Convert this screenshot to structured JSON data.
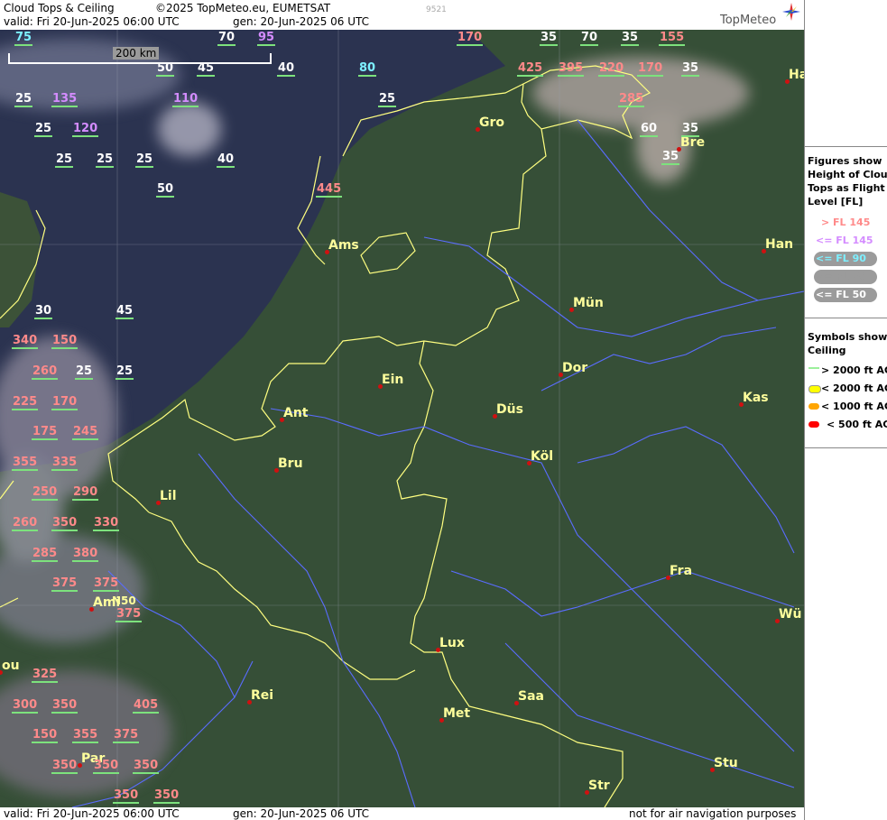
{
  "header": {
    "title": "Cloud Tops & Ceiling",
    "copyright": "©2025 TopMeteo.eu, EUMETSAT",
    "valid": "valid:  Fri  20-Jun-2025  06:00 UTC",
    "gen": "gen: 20-Jun-2025 06 UTC",
    "id": "9521",
    "brand": "TopMeteo"
  },
  "footer": {
    "valid": "valid:  Fri  20-Jun-2025  06:00 UTC",
    "gen": "gen: 20-Jun-2025 06 UTC",
    "disclaimer": "not for air navigation purposes"
  },
  "scale": {
    "label": "200 km"
  },
  "grid_label": "N50",
  "legend": {
    "heights_title": [
      "Figures show",
      "Height of Cloud",
      "Tops as Flight",
      "Level  [FL]"
    ],
    "heights": [
      {
        "label": "> FL 145",
        "color": "#ff8a8a"
      },
      {
        "label": "<= FL 145",
        "color": "#d48cff"
      },
      {
        "label": "<= FL 90",
        "color": "#7df0ff"
      },
      {
        "label": "<= FL 70",
        "color": "#9b9b9b"
      },
      {
        "label": "<= FL 50",
        "color": "#ffffff"
      }
    ],
    "symbols_title": [
      "Symbols show",
      "Ceiling"
    ],
    "symbols": [
      {
        "label": "> 2000 ft AGL",
        "color": "#9cf09c"
      },
      {
        "label": "< 2000 ft AGL",
        "color": "#ffff00"
      },
      {
        "label": "< 1000 ft AGL",
        "color": "#ffa500"
      },
      {
        "label": "< 500 ft AGL",
        "color": "#ff0000"
      }
    ]
  },
  "cities": [
    {
      "name": "Gro"
    },
    {
      "name": "Bre"
    },
    {
      "name": "Ha"
    },
    {
      "name": "Ams"
    },
    {
      "name": "Han"
    },
    {
      "name": "Mün"
    },
    {
      "name": "Ein"
    },
    {
      "name": "Dor"
    },
    {
      "name": "Ant"
    },
    {
      "name": "Düs"
    },
    {
      "name": "Kas"
    },
    {
      "name": "Köl"
    },
    {
      "name": "Bru"
    },
    {
      "name": "Lil"
    },
    {
      "name": "Fra"
    },
    {
      "name": "Ami"
    },
    {
      "name": "Wü"
    },
    {
      "name": "Lux"
    },
    {
      "name": "ou"
    },
    {
      "name": "Rei"
    },
    {
      "name": "Saa"
    },
    {
      "name": "Met"
    },
    {
      "name": "Stu"
    },
    {
      "name": "Par"
    },
    {
      "name": "Str"
    }
  ],
  "cloud_tops": [
    {
      "v": "75",
      "c": "c"
    },
    {
      "v": "70",
      "c": "w"
    },
    {
      "v": "95",
      "c": "v"
    },
    {
      "v": "170",
      "c": "p"
    },
    {
      "v": "35",
      "c": "w"
    },
    {
      "v": "70",
      "c": "w"
    },
    {
      "v": "35",
      "c": "w"
    },
    {
      "v": "155",
      "c": "p"
    },
    {
      "v": "50",
      "c": "w"
    },
    {
      "v": "45",
      "c": "w"
    },
    {
      "v": "40",
      "c": "w"
    },
    {
      "v": "80",
      "c": "c"
    },
    {
      "v": "425",
      "c": "p"
    },
    {
      "v": "395",
      "c": "p"
    },
    {
      "v": "220",
      "c": "p"
    },
    {
      "v": "170",
      "c": "p"
    },
    {
      "v": "35",
      "c": "w"
    },
    {
      "v": "25",
      "c": "w"
    },
    {
      "v": "135",
      "c": "v"
    },
    {
      "v": "110",
      "c": "v"
    },
    {
      "v": "25",
      "c": "w"
    },
    {
      "v": "285",
      "c": "p"
    },
    {
      "v": "25",
      "c": "w"
    },
    {
      "v": "120",
      "c": "v"
    },
    {
      "v": "60",
      "c": "w"
    },
    {
      "v": "35",
      "c": "w"
    },
    {
      "v": "25",
      "c": "w"
    },
    {
      "v": "25",
      "c": "w"
    },
    {
      "v": "25",
      "c": "w"
    },
    {
      "v": "40",
      "c": "w"
    },
    {
      "v": "35",
      "c": "w"
    },
    {
      "v": "50",
      "c": "w"
    },
    {
      "v": "445",
      "c": "p"
    },
    {
      "v": "30",
      "c": "w"
    },
    {
      "v": "45",
      "c": "w"
    },
    {
      "v": "340",
      "c": "p"
    },
    {
      "v": "150",
      "c": "p"
    },
    {
      "v": "260",
      "c": "p"
    },
    {
      "v": "25",
      "c": "w"
    },
    {
      "v": "25",
      "c": "w"
    },
    {
      "v": "225",
      "c": "p"
    },
    {
      "v": "170",
      "c": "p"
    },
    {
      "v": "175",
      "c": "p"
    },
    {
      "v": "245",
      "c": "p"
    },
    {
      "v": "355",
      "c": "p"
    },
    {
      "v": "335",
      "c": "p"
    },
    {
      "v": "250",
      "c": "p"
    },
    {
      "v": "290",
      "c": "p"
    },
    {
      "v": "260",
      "c": "p"
    },
    {
      "v": "350",
      "c": "p"
    },
    {
      "v": "330",
      "c": "p"
    },
    {
      "v": "285",
      "c": "p"
    },
    {
      "v": "380",
      "c": "p"
    },
    {
      "v": "375",
      "c": "p"
    },
    {
      "v": "375",
      "c": "p"
    },
    {
      "v": "375",
      "c": "p"
    },
    {
      "v": "325",
      "c": "p"
    },
    {
      "v": "300",
      "c": "p"
    },
    {
      "v": "350",
      "c": "p"
    },
    {
      "v": "405",
      "c": "p"
    },
    {
      "v": "150",
      "c": "p"
    },
    {
      "v": "355",
      "c": "p"
    },
    {
      "v": "375",
      "c": "p"
    },
    {
      "v": "350",
      "c": "p"
    },
    {
      "v": "350",
      "c": "p"
    },
    {
      "v": "350",
      "c": "p"
    },
    {
      "v": "350",
      "c": "p"
    },
    {
      "v": "350",
      "c": "p"
    }
  ]
}
